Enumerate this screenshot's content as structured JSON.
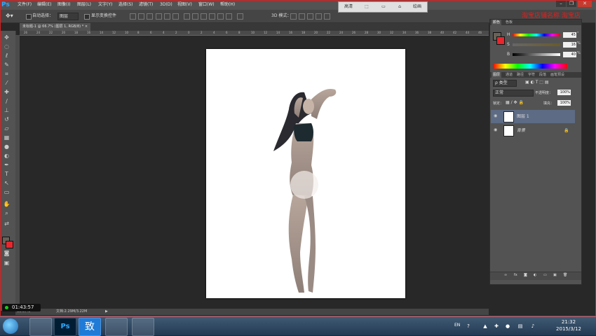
{
  "app": {
    "logo": "Ps"
  },
  "menu": [
    "文件(F)",
    "编辑(E)",
    "图像(I)",
    "图层(L)",
    "文字(Y)",
    "选择(S)",
    "滤镜(T)",
    "3D(D)",
    "视图(V)",
    "窗口(W)",
    "帮助(H)"
  ],
  "window_controls": {
    "minimize": "–",
    "restore": "❐",
    "close": "✕"
  },
  "options": {
    "auto_select_label": "自动选择：",
    "auto_select_value": "图层",
    "show_transform_label": "显示变换控件",
    "mode_3d_label": "3D 模式："
  },
  "workspace": {
    "buttons": [
      "高清",
      "",
      "",
      "",
      "绘画"
    ]
  },
  "overlay_red_text": "淘宝店铺名称  淘宝店",
  "document": {
    "tab_label": "未标题-1 @ 66.7% (图层 1, RGB/8) *",
    "close_icon": "×"
  },
  "ruler_h": [
    "26",
    "24",
    "22",
    "20",
    "18",
    "16",
    "14",
    "12",
    "10",
    "8",
    "6",
    "4",
    "2",
    "0",
    "2",
    "4",
    "6",
    "8",
    "10",
    "12",
    "14",
    "16",
    "18",
    "20",
    "22",
    "24",
    "26",
    "28",
    "30",
    "32",
    "34",
    "36",
    "38",
    "40",
    "42",
    "44",
    "46"
  ],
  "statusbar": {
    "zoom": "66.67%",
    "doc_info": "文档:2.29M/3.22M"
  },
  "timer": "01:43:57",
  "color_panel": {
    "tabs": [
      "颜色",
      "色板"
    ],
    "rows": [
      {
        "label": "H",
        "value": "45",
        "unit": "°"
      },
      {
        "label": "S",
        "value": "16",
        "unit": "%"
      },
      {
        "label": "B",
        "value": "40",
        "unit": "%"
      }
    ]
  },
  "layers_panel": {
    "tabs": [
      "图层",
      "通道",
      "路径",
      "字符",
      "段落",
      "画笔预设"
    ],
    "filter_label": "ρ 类型",
    "blend_mode": "正常",
    "opacity_label": "不透明度：",
    "opacity_value": "100%",
    "lock_label": "锁定：",
    "fill_label": "填充：",
    "fill_value": "100%",
    "layers": [
      {
        "name": "图层 1",
        "selected": true
      },
      {
        "name": "背景",
        "selected": false
      }
    ],
    "footer_icons": [
      "link-icon",
      "fx-icon",
      "mask-icon",
      "adjustment-icon",
      "folder-icon",
      "new-layer-icon",
      "trash-icon"
    ]
  },
  "taskbar": {
    "time": "21:32",
    "date": "2015/3/12",
    "lang": "EN",
    "apps": [
      "explorer",
      "photoshop",
      "致",
      "chrome",
      "game"
    ]
  },
  "colors": {
    "accent": "#31a8ff",
    "foreground": "#686258",
    "background": "#e8262e",
    "selected_layer": "#5d6b84"
  }
}
